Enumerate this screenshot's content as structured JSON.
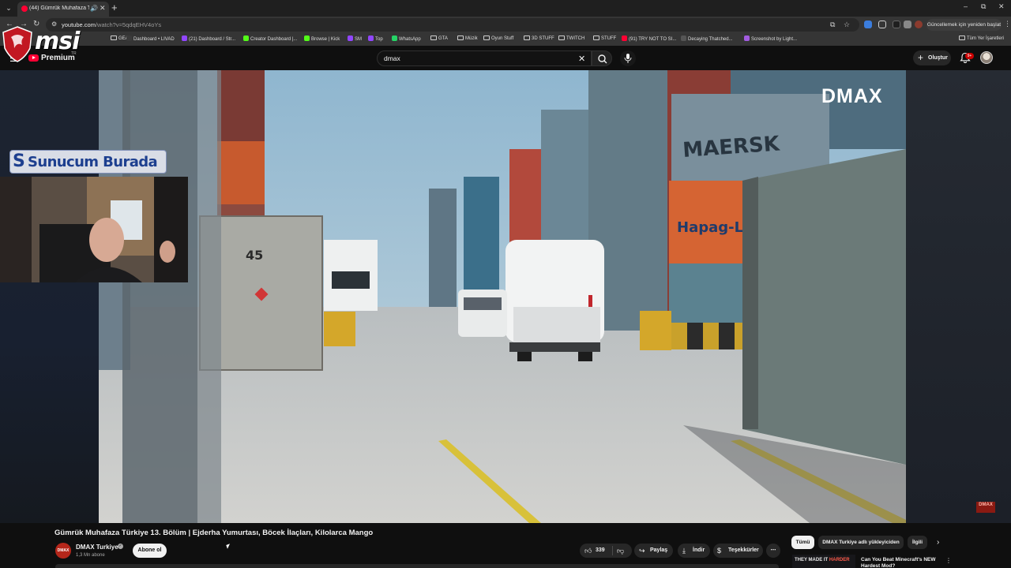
{
  "browser": {
    "tab": {
      "title": "(44) Gümrük Muhafaza Tür...",
      "favicon": "youtube-icon",
      "audio": "speaker-icon"
    },
    "window_controls": [
      "–",
      "⧉",
      "✕"
    ],
    "url": {
      "host": "youtube.com",
      "path": "/watch?v=5qdqEHV4oYs"
    },
    "update_button": "Güncellemek için yeniden başlat",
    "bookmarks": [
      {
        "label": "GEAR",
        "icon": "folder-icon"
      },
      {
        "label": "Dashboard • LIVAD",
        "icon": "site-icon",
        "color": "#3a3a3a"
      },
      {
        "label": "(21) Dashboard / Str...",
        "icon": "site-icon",
        "color": "#9146ff"
      },
      {
        "label": "Creator Dashboard |...",
        "icon": "kick-icon",
        "color": "#53fc18"
      },
      {
        "label": "Browse | Kick",
        "icon": "kick-icon",
        "color": "#53fc18"
      },
      {
        "label": "SM",
        "icon": "twitch-icon",
        "color": "#9146ff"
      },
      {
        "label": "Top",
        "icon": "twitch-icon",
        "color": "#9146ff"
      },
      {
        "label": "WhatsApp",
        "icon": "whatsapp-icon",
        "color": "#25d366"
      },
      {
        "label": "GTA",
        "icon": "folder-icon"
      },
      {
        "label": "Müzik",
        "icon": "folder-icon"
      },
      {
        "label": "Oyun Stuff",
        "icon": "folder-icon"
      },
      {
        "label": "3D STUFF",
        "icon": "folder-icon"
      },
      {
        "label": "TWITCH",
        "icon": "folder-icon"
      },
      {
        "label": "STUFF",
        "icon": "folder-icon"
      },
      {
        "label": "(91) TRY NOT TO SI...",
        "icon": "youtube-icon",
        "color": "#ff0033"
      },
      {
        "label": "Decaying Thatched...",
        "icon": "site-icon",
        "color": "#555555"
      },
      {
        "label": "Screenshot by Light...",
        "icon": "lightshot-icon",
        "color": "#a25ce0"
      }
    ],
    "all_bookmarks": "Tüm Yer İşaretleri"
  },
  "overlay": {
    "msi_logo": "msi",
    "sunucum": "Sunucum Burada",
    "sunucum_mark": "S"
  },
  "youtube": {
    "logo_text": "Premium",
    "logo_tm": "TR",
    "search_query": "dmax",
    "create_label": "Oluştur",
    "notifications_badge": "9+",
    "video": {
      "brand_watermark": "DMAX",
      "corner_watermark": "DMAX",
      "container_number": "45",
      "container_brand_1": "MAERSK",
      "container_brand_2": "Hapag-Lloyd",
      "title": "Gümrük Muhafaza Türkiye 13. Bölüm | Ejderha Yumurtası, Böcek İlaçları, Kilolarca Mango"
    },
    "channel": {
      "avatar_text": "DMAX",
      "name": "DMAX Turkiye",
      "subscribers": "1,3 Mn abone",
      "subscribe_label": "Abone ol"
    },
    "actions": {
      "likes": "339",
      "share": "Paylaş",
      "download": "İndir",
      "thanks": "Teşekkürler",
      "more": "⋯"
    },
    "chips": [
      "Tümü",
      "DMAX Turkiye adlı yükleyiciden",
      "İlgili"
    ],
    "related": {
      "thumb_text_a": "THEY MADE IT ",
      "thumb_text_b": "HARDER",
      "title": "Can You Beat Minecraft's NEW Hardest Mod?"
    }
  },
  "colors": {
    "youtube_red": "#ff0033",
    "background": "#0f0f0f",
    "chip_bg": "#272727"
  }
}
